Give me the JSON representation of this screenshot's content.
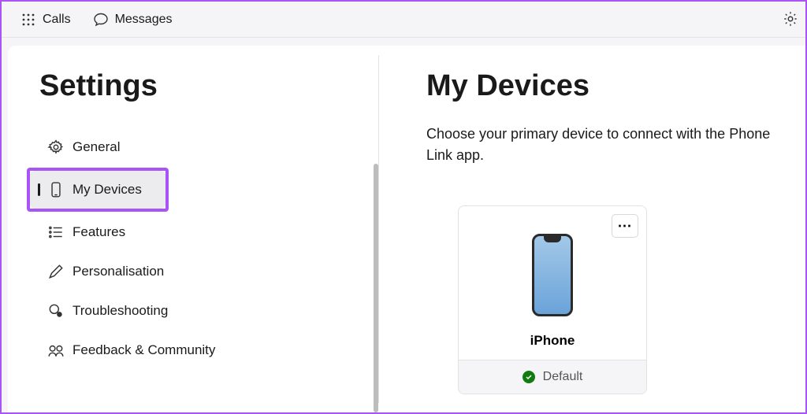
{
  "tabs": {
    "calls": "Calls",
    "messages": "Messages"
  },
  "sidebar": {
    "title": "Settings",
    "items": [
      {
        "label": "General",
        "icon": "gear"
      },
      {
        "label": "My Devices",
        "icon": "phone",
        "selected": true
      },
      {
        "label": "Features",
        "icon": "list"
      },
      {
        "label": "Personalisation",
        "icon": "pen"
      },
      {
        "label": "Troubleshooting",
        "icon": "troubleshoot"
      },
      {
        "label": "Feedback & Community",
        "icon": "feedback"
      }
    ]
  },
  "content": {
    "title": "My Devices",
    "description": "Choose your primary device to connect with the Phone Link app."
  },
  "device": {
    "name": "iPhone",
    "status": "Default",
    "more": "⋯"
  }
}
